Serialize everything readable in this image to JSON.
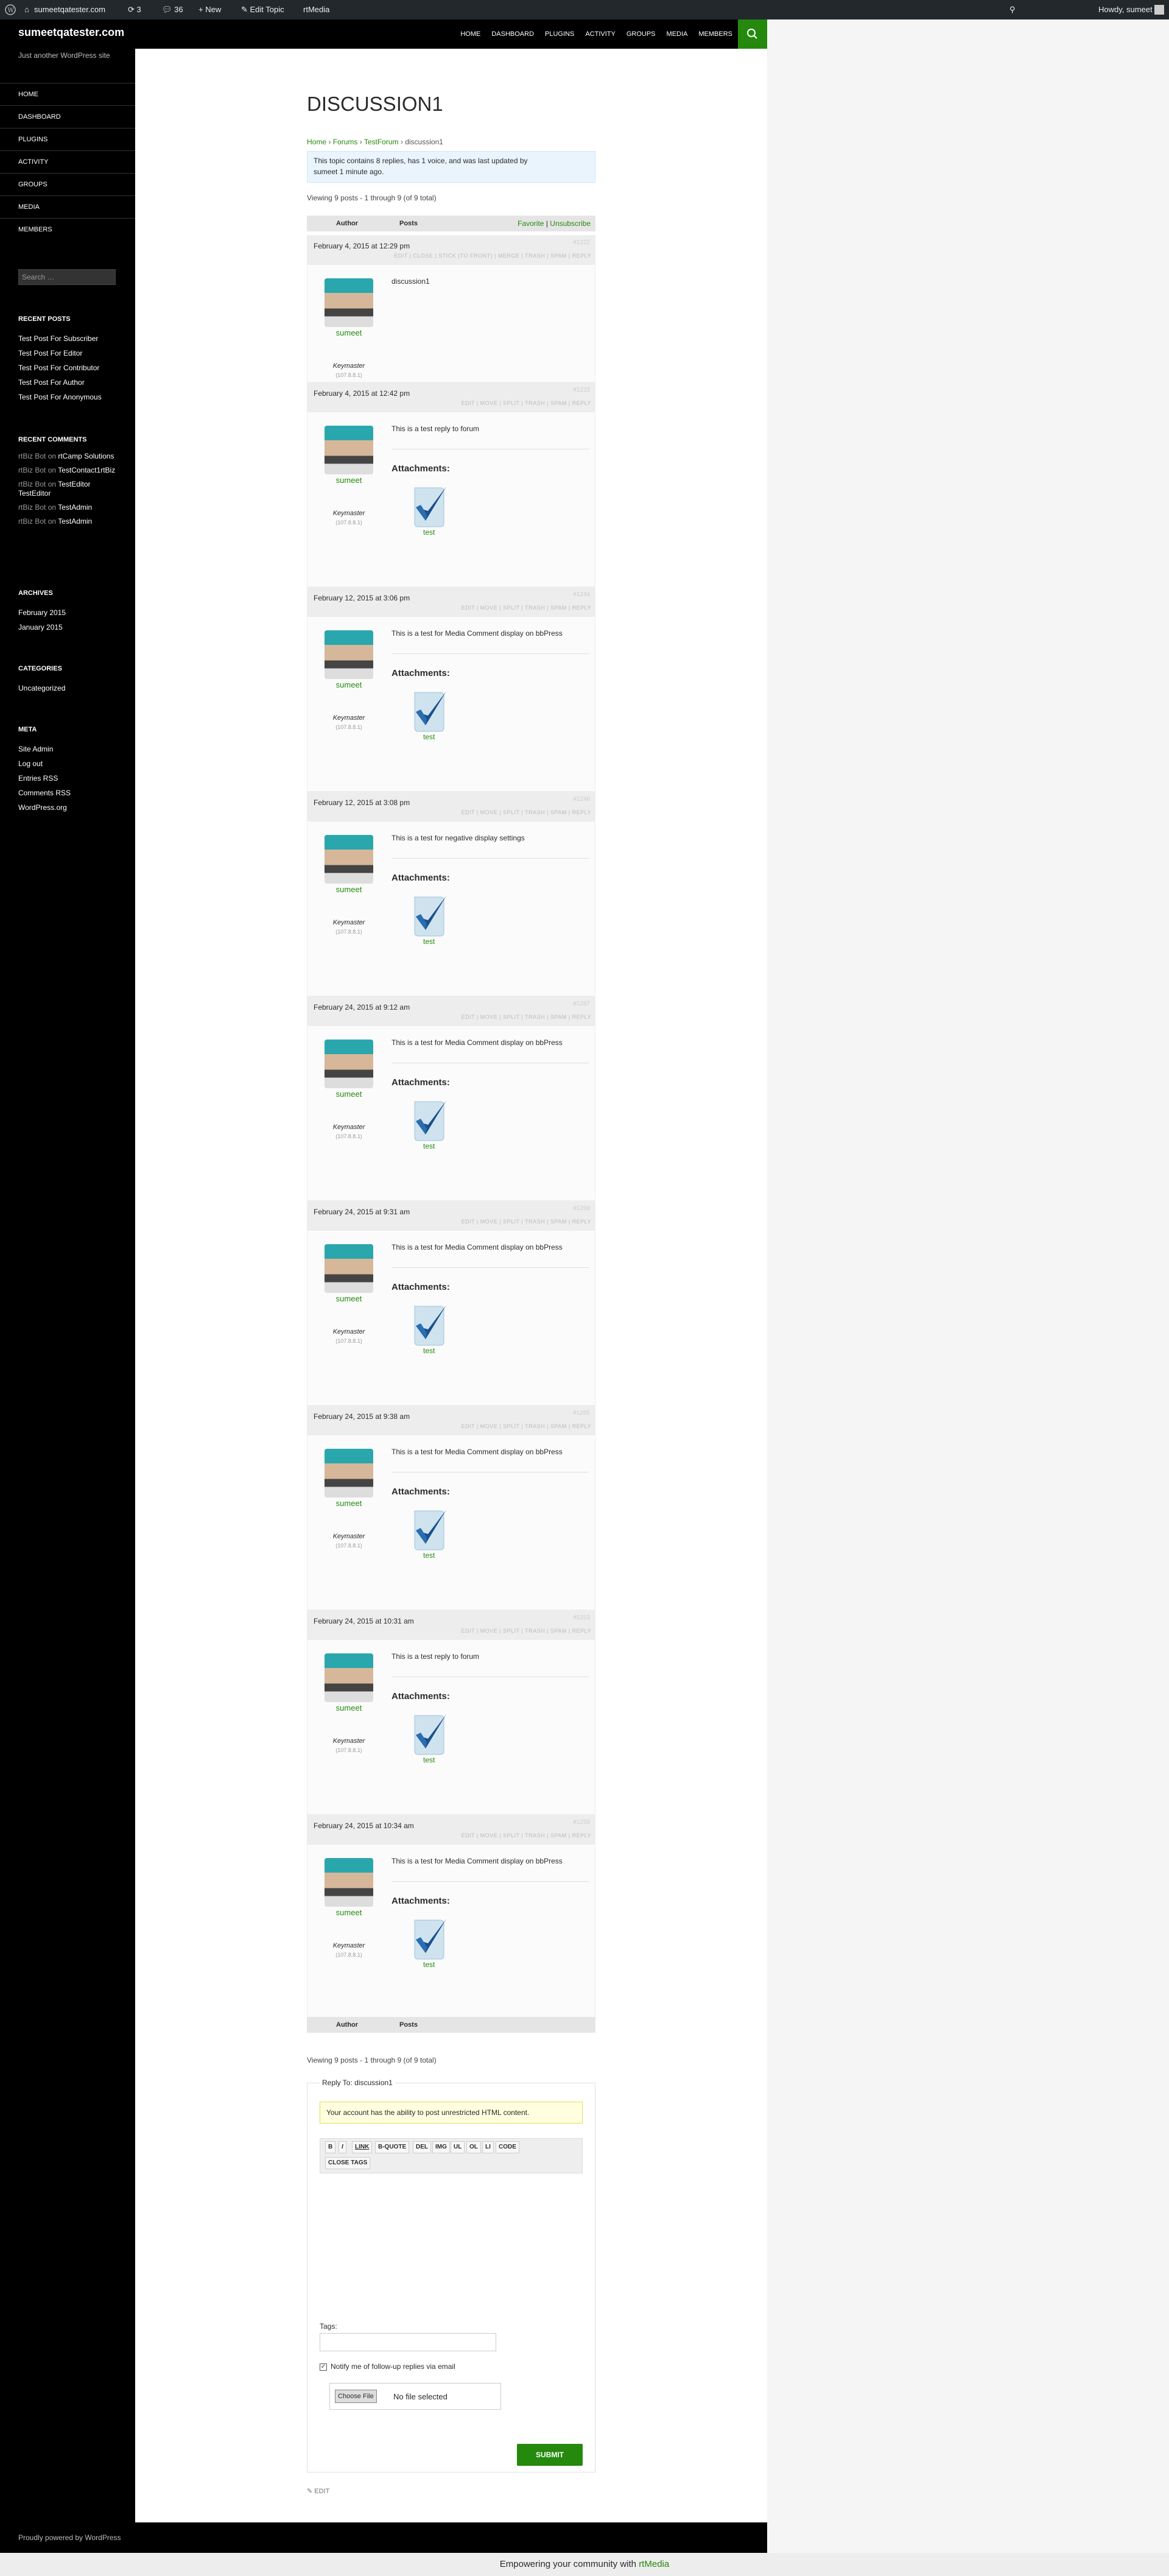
{
  "adminbar": {
    "site": "sumeetqatester.com",
    "updates": "3",
    "comments": "36",
    "new": "New",
    "edit": "Edit Topic",
    "rtmedia": "rtMedia",
    "howdy": "Howdy, sumeet"
  },
  "site": {
    "title": "sumeetqatester.com",
    "description": "Just another WordPress site",
    "nav": [
      "HOME",
      "DASHBOARD",
      "PLUGINS",
      "ACTIVITY",
      "GROUPS",
      "MEDIA",
      "MEMBERS"
    ]
  },
  "sidebar": {
    "search_placeholder": "Search …",
    "recent_posts_title": "RECENT POSTS",
    "recent_posts": [
      "Test Post For Subscriber",
      "Test Post For Editor",
      "Test Post For Contributor",
      "Test Post For Author",
      "Test Post For Anonymous"
    ],
    "recent_comments_title": "RECENT COMMENTS",
    "recent_comments": [
      {
        "a": "rtBiz Bot",
        "on": "on",
        "t": "rtCamp Solutions"
      },
      {
        "a": "rtBiz Bot",
        "on": "on",
        "t": "TestContact1rtBiz"
      },
      {
        "a": "rtBiz Bot",
        "on": "on",
        "t": "TestEditor TestEditor"
      },
      {
        "a": "rtBiz Bot",
        "on": "on",
        "t": "TestAdmin"
      },
      {
        "a": "rtBiz Bot",
        "on": "on",
        "t": "TestAdmin"
      }
    ],
    "archives_title": "ARCHIVES",
    "archives": [
      "February 2015",
      "January 2015"
    ],
    "categories_title": "CATEGORIES",
    "categories": [
      "Uncategorized"
    ],
    "meta_title": "META",
    "meta": [
      "Site Admin",
      "Log out",
      "Entries RSS",
      "Comments RSS",
      "WordPress.org"
    ]
  },
  "topic": {
    "title": "DISCUSSION1",
    "crumbs": {
      "home": "Home",
      "forums": "Forums",
      "forum": "TestForum",
      "current": "discussion1",
      "sep": "›"
    },
    "info_line1": "This topic contains 8 replies, has 1 voice, and was last updated by",
    "info_line2": "sumeet 1 minute ago.",
    "viewing": "Viewing 9 posts - 1 through 9 (of 9 total)",
    "author_col": "Author",
    "posts_col": "Posts",
    "favorite": "Favorite",
    "sep": "|",
    "unsubscribe": "Unsubscribe",
    "attachments_label": "Attachments:",
    "attachment_name": "test",
    "user": {
      "name": "sumeet",
      "role": "Keymaster",
      "ip": "(107.8.8.1)"
    },
    "topic_admin": "EDIT | CLOSE | STICK (TO FRONT) | MERGE | TRASH | SPAM | REPLY",
    "reply_admin": "EDIT | MOVE | SPLIT | TRASH | SPAM | REPLY",
    "replies": [
      {
        "date": "February 4, 2015 at 12:29 pm",
        "id": "#1222",
        "text": "discussion1",
        "att": false,
        "topic": true
      },
      {
        "date": "February 4, 2015 at 12:42 pm",
        "id": "#1223",
        "text": "This is a test reply to forum",
        "att": true
      },
      {
        "date": "February 12, 2015 at 3:06 pm",
        "id": "#1244",
        "text": "This is a test for Media Comment display on bbPress",
        "att": true
      },
      {
        "date": "February 12, 2015 at 3:08 pm",
        "id": "#1246",
        "text": "This is a test for negative display settings",
        "att": true
      },
      {
        "date": "February 24, 2015 at 9:12 am",
        "id": "#1267",
        "text": "This is a test for Media Comment display on bbPress",
        "att": true
      },
      {
        "date": "February 24, 2015 at 9:31 am",
        "id": "#1269",
        "text": "This is a test for Media Comment display on bbPress",
        "att": true
      },
      {
        "date": "February 24, 2015 at 9:38 am",
        "id": "#1265",
        "text": "This is a test for Media Comment display on bbPress",
        "att": true
      },
      {
        "date": "February 24, 2015 at 10:31 am",
        "id": "#1253",
        "text": "This is a test reply to forum",
        "att": true
      },
      {
        "date": "February 24, 2015 at 10:34 am",
        "id": "#1259",
        "text": "This is a test for Media Comment display on bbPress",
        "att": true
      }
    ]
  },
  "form": {
    "legend": "Reply To: discussion1",
    "notice": "Your account has the ability to post unrestricted HTML content.",
    "buttons": [
      "B",
      "I",
      "LINK",
      "B-QUOTE",
      "DEL",
      "IMG",
      "UL",
      "OL",
      "LI",
      "CODE",
      "CLOSE TAGS"
    ],
    "tags_label": "Tags:",
    "notify": "Notify me of follow-up replies via email",
    "checkmark": "✓",
    "choose": "Choose File",
    "nofile": "No file selected",
    "submit": "SUBMIT",
    "edit": "EDIT"
  },
  "footer": {
    "text": "Proudly powered by WordPress"
  },
  "rtbar": {
    "text": "Empowering your community with",
    "brand": "rtMedia"
  }
}
